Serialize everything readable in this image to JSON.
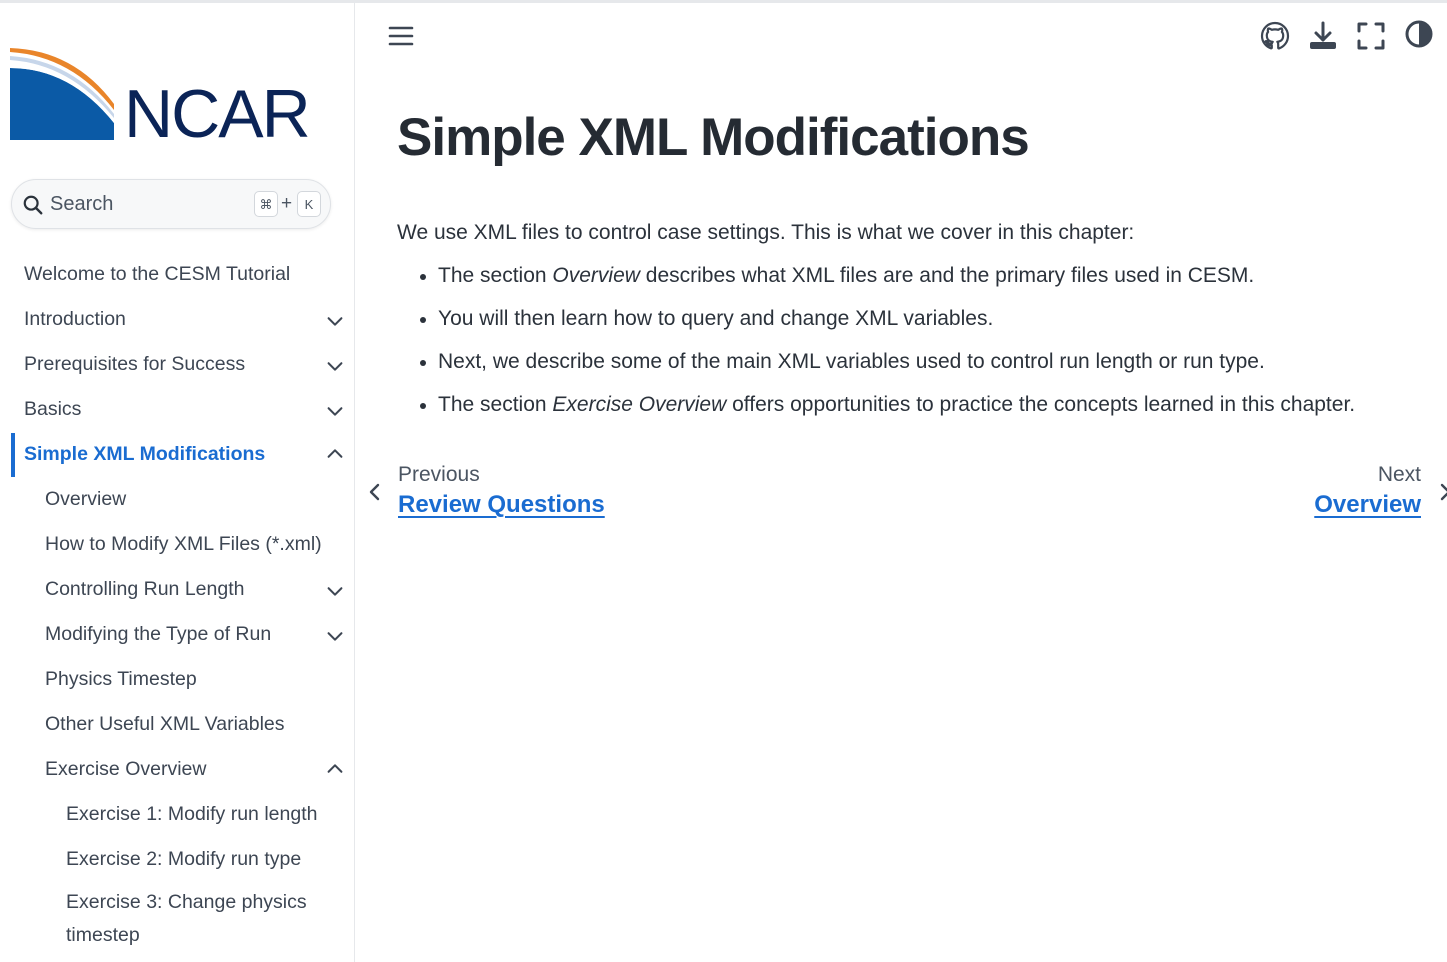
{
  "brand": {
    "logo_text": "NCAR",
    "colors": {
      "primary_blue": "#0b5aa6",
      "navy": "#0b2457",
      "orange": "#e9852a",
      "accent": "#1a6cd1"
    }
  },
  "search": {
    "label": "Search",
    "shortcut_mod": "⌘",
    "shortcut_plus": "+",
    "shortcut_key": "K",
    "icon": "search-icon"
  },
  "sidebar": {
    "items": [
      {
        "label": "Welcome to the CESM Tutorial",
        "expandable": false
      },
      {
        "label": "Introduction",
        "expandable": true,
        "expanded": false
      },
      {
        "label": "Prerequisites for Success",
        "expandable": true,
        "expanded": false
      },
      {
        "label": "Basics",
        "expandable": true,
        "expanded": false
      },
      {
        "label": "Simple XML Modifications",
        "expandable": true,
        "expanded": true,
        "active": true
      },
      {
        "label": "Overview",
        "expandable": false
      },
      {
        "label": "How to Modify XML Files (*.xml)",
        "expandable": false
      },
      {
        "label": "Controlling Run Length",
        "expandable": true,
        "expanded": false
      },
      {
        "label": "Modifying the Type of Run",
        "expandable": true,
        "expanded": false
      },
      {
        "label": "Physics Timestep",
        "expandable": false
      },
      {
        "label": "Other Useful XML Variables",
        "expandable": false
      },
      {
        "label": "Exercise Overview",
        "expandable": true,
        "expanded": true
      },
      {
        "label": "Exercise 1: Modify run length",
        "expandable": false
      },
      {
        "label": "Exercise 2: Modify run type",
        "expandable": false
      },
      {
        "label": "Exercise 3: Change physics timestep",
        "expandable": false
      }
    ]
  },
  "header": {
    "menu_icon": "hamburger-icon",
    "actions": [
      "github-icon",
      "download-icon",
      "fullscreen-icon",
      "theme-toggle-icon"
    ]
  },
  "main": {
    "title": "Simple XML Modifications",
    "intro": "We use XML files to control case settings. This is what we cover in this chapter:",
    "bullets": [
      {
        "before": "The section ",
        "em": "Overview",
        "after": " describes what XML files are and the primary files used in CESM."
      },
      {
        "before": "You will then learn how to query and change XML variables.",
        "em": "",
        "after": ""
      },
      {
        "before": "Next, we describe some of the main XML variables used to control run length or run type.",
        "em": "",
        "after": ""
      },
      {
        "before": "The section ",
        "em": "Exercise Overview",
        "after": " offers opportunities to practice the concepts learned in this chapter."
      }
    ]
  },
  "pager": {
    "prev_label": "Previous",
    "prev_title": "Review Questions",
    "next_label": "Next",
    "next_title": "Overview"
  }
}
